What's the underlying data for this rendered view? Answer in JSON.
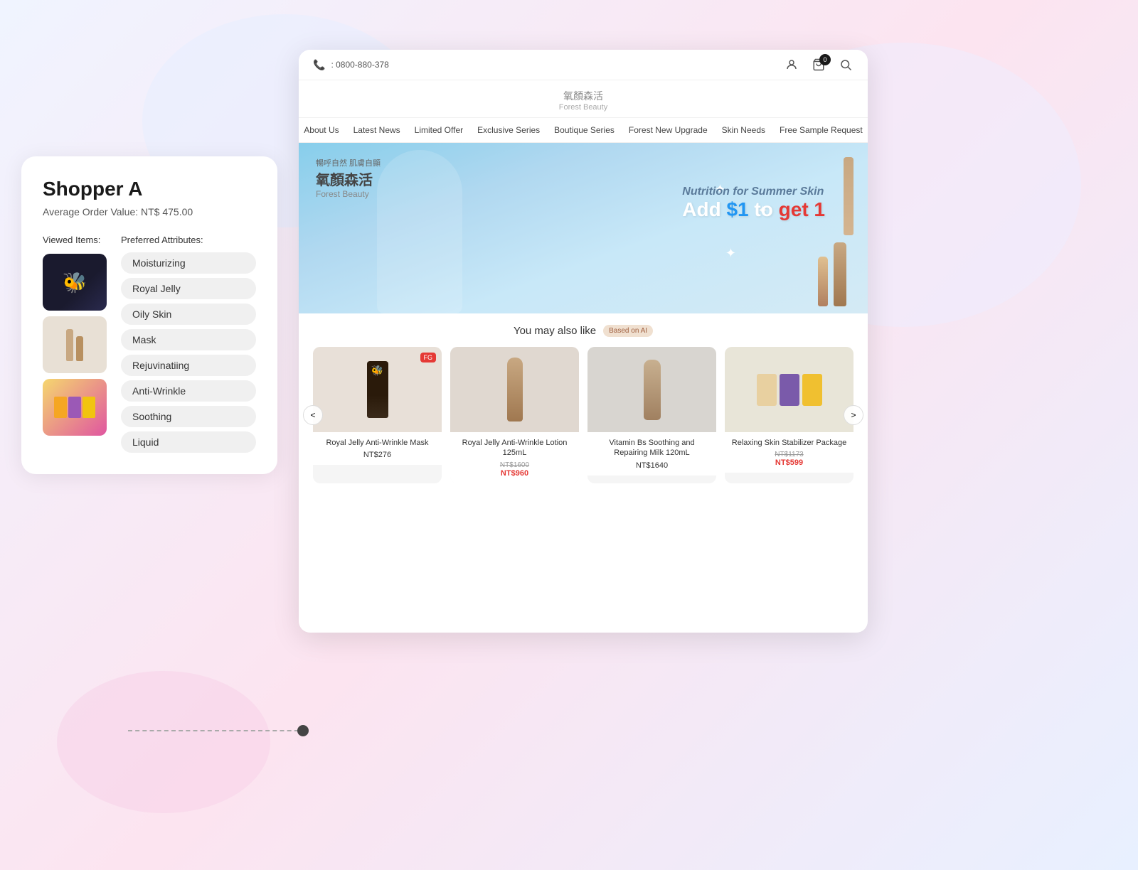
{
  "background": {
    "color": "#f0f4ff"
  },
  "shopper_card": {
    "title": "Shopper A",
    "aov_label": "Average Order Value: NT$ 475.00",
    "viewed_items_label": "Viewed Items:",
    "preferred_attr_label": "Preferred Attributes:",
    "attributes": [
      {
        "label": "Moisturizing"
      },
      {
        "label": "Royal Jelly"
      },
      {
        "label": "Oily Skin"
      },
      {
        "label": "Mask"
      },
      {
        "label": "Rejuvinatiing"
      },
      {
        "label": "Anti-Wrinkle"
      },
      {
        "label": "Soothing"
      },
      {
        "label": "Liquid"
      }
    ]
  },
  "browser": {
    "phone": ": 0800-880-378",
    "cart_count": "0",
    "brand_zh": "氧顏森活",
    "brand_subtitle": "暢呼自然 肌膚自顯",
    "brand_en": "Forest Beauty",
    "nav_items": [
      {
        "label": "About Us"
      },
      {
        "label": "Latest News"
      },
      {
        "label": "Limited Offer"
      },
      {
        "label": "Exclusive Series"
      },
      {
        "label": "Boutique Series"
      },
      {
        "label": "Forest New Upgrade"
      },
      {
        "label": "Skin Needs"
      },
      {
        "label": "Free Sample Request"
      }
    ],
    "hero": {
      "brand_zh": "氧顏森活",
      "brand_subtitle": "暢呼自然 肌膚自顯",
      "brand_en": "Forest Beauty",
      "line1": "Nutrition for Summer Skin",
      "line2_1": "Add ",
      "line2_2": "$1",
      "line2_3": " to ",
      "line2_4": "get 1"
    },
    "also_like": {
      "title": "You may also like",
      "badge": "Based on AI",
      "prev": "<",
      "next": ">",
      "products": [
        {
          "name": "Royal Jelly Anti-Wrinkle Mask",
          "price": "NT$276",
          "original_price": null,
          "sale_price": null,
          "has_badge": true,
          "badge_text": "FG"
        },
        {
          "name": "Royal Jelly Anti-Wrinkle Lotion 125mL",
          "price": null,
          "original_price": "NT$1600",
          "sale_price": "NT$960",
          "has_badge": false
        },
        {
          "name": "Vitamin Bs Soothing and Repairing Milk 120mL",
          "price": "NT$1640",
          "original_price": null,
          "sale_price": null,
          "has_badge": false
        },
        {
          "name": "Relaxing Skin Stabilizer Package",
          "price": null,
          "original_price": "NT$1173",
          "sale_price": "NT$599",
          "has_badge": false
        }
      ]
    }
  }
}
